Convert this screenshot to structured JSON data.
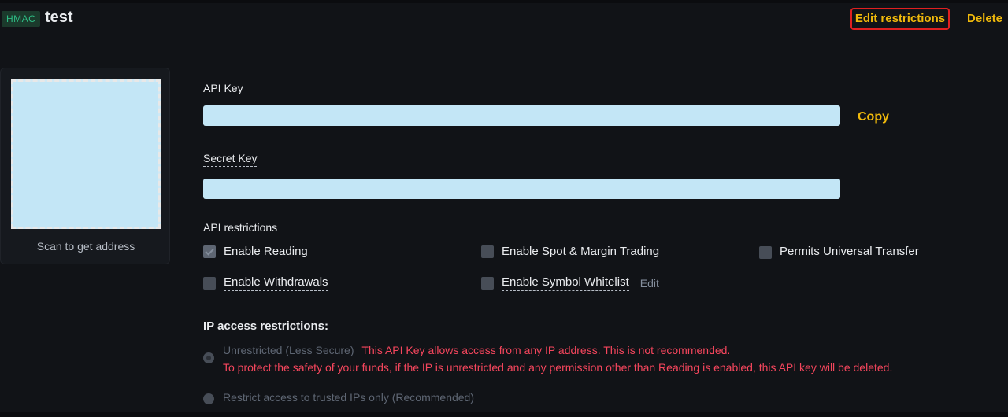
{
  "header": {
    "badge": "HMAC",
    "title": "test",
    "edit_restrictions": "Edit restrictions",
    "delete": "Delete"
  },
  "qr": {
    "caption": "Scan to get address"
  },
  "api_key": {
    "label": "API Key",
    "value": "",
    "copy": "Copy"
  },
  "secret_key": {
    "label": "Secret Key",
    "value": ""
  },
  "restrictions": {
    "heading": "API restrictions",
    "items": [
      {
        "label": "Enable Reading",
        "checked": true
      },
      {
        "label": "Enable Spot & Margin Trading",
        "checked": false
      },
      {
        "label": "Permits Universal Transfer",
        "checked": false
      },
      {
        "label": "Enable Withdrawals",
        "checked": false
      },
      {
        "label": "Enable Symbol Whitelist",
        "checked": false
      }
    ],
    "whitelist_edit": "Edit"
  },
  "ip": {
    "heading": "IP access restrictions:",
    "unrestricted_label": "Unrestricted (Less Secure)",
    "warning_line1": "This API Key allows access from any IP address. This is not recommended.",
    "warning_line2": "To protect the safety of your funds, if the IP is unrestricted and any permission other than Reading is enabled, this API key will be deleted.",
    "restrict_label": "Restrict access to trusted IPs only (Recommended)"
  },
  "colors": {
    "accent": "#f0b90b",
    "warning": "#f6465d",
    "highlight_border": "#e02020",
    "masked_field": "#c3e6f6"
  }
}
